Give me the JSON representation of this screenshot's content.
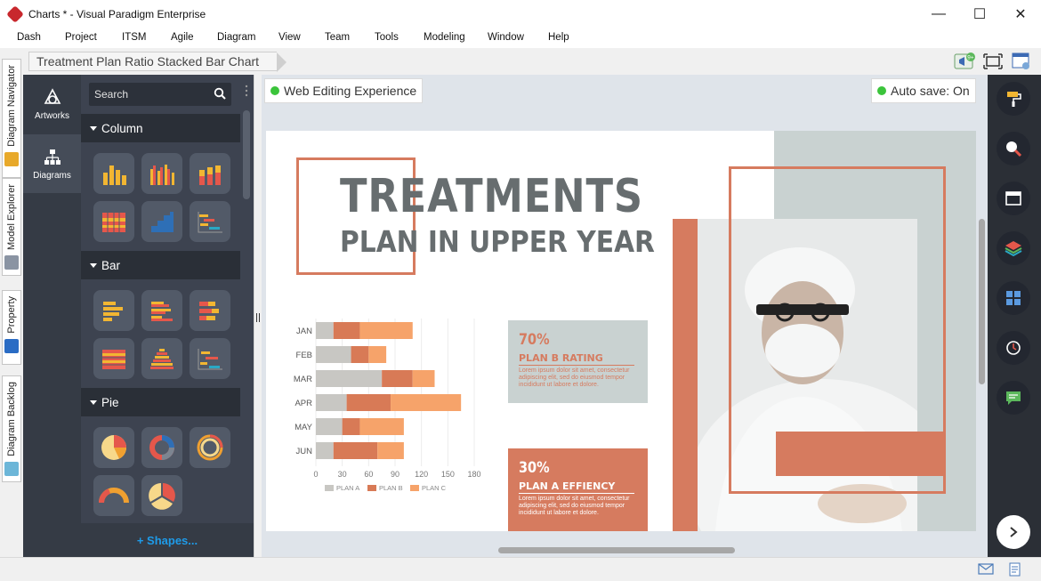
{
  "window": {
    "title": "Charts * - Visual Paradigm Enterprise",
    "minimize": "—",
    "maximize": "☐",
    "close": "✕"
  },
  "menu": [
    "Dash",
    "Project",
    "ITSM",
    "Agile",
    "Diagram",
    "View",
    "Team",
    "Tools",
    "Modeling",
    "Window",
    "Help"
  ],
  "breadcrumb": "Treatment Plan Ratio Stacked Bar Chart",
  "toolbar": {
    "notification_badge": "9+"
  },
  "left_tabs": [
    "Diagram Navigator",
    "Model Explorer",
    "Property",
    "Diagram Backlog"
  ],
  "palette": {
    "tabs": [
      {
        "label": "Artworks"
      },
      {
        "label": "Diagrams"
      }
    ],
    "search_placeholder": "Search",
    "sections": [
      {
        "label": "Column"
      },
      {
        "label": "Bar"
      },
      {
        "label": "Pie"
      }
    ],
    "shapes_link": "+ Shapes..."
  },
  "canvas": {
    "web_editing": "Web Editing Experience",
    "auto_save": "Auto save: On"
  },
  "infographic": {
    "title_line1": "TREATMENTS",
    "title_line2": "PLAN IN UPPER YEAR",
    "card_b": {
      "percent": "70%",
      "heading": "PLAN B RATING",
      "body": "Lorem ipsum dolor sit amet, consectetur adipiscing elit, sed do eiusmod tempor incididunt ut labore et dolore."
    },
    "card_a": {
      "percent": "30%",
      "heading": "PLAN A EFFIENCY",
      "body": "Lorem ipsum dolor sit amet, consectetur adipiscing elit, sed do eiusmod tempor incididunt ut labore et dolore."
    }
  },
  "chart_data": {
    "type": "bar",
    "orientation": "horizontal",
    "stacked": true,
    "categories": [
      "JAN",
      "FEB",
      "MAR",
      "APR",
      "MAY",
      "JUN"
    ],
    "series": [
      {
        "name": "PLAN A",
        "color": "#c8c7c3",
        "values": [
          20,
          40,
          75,
          35,
          30,
          20
        ]
      },
      {
        "name": "PLAN B",
        "color": "#d87a56",
        "values": [
          30,
          20,
          35,
          50,
          20,
          50
        ]
      },
      {
        "name": "PLAN C",
        "color": "#f6a36a",
        "values": [
          60,
          20,
          25,
          80,
          50,
          30
        ]
      }
    ],
    "xticks": [
      "0",
      "30",
      "60",
      "90",
      "120",
      "150",
      "180"
    ],
    "xlim": [
      0,
      180
    ],
    "legend": "bottom"
  },
  "colors": {
    "accent": "#d67b5f",
    "panel": "#c9d2d1",
    "sidebar": "#3d4350",
    "green_dot": "#3bc43b",
    "link": "#1e9be9"
  }
}
